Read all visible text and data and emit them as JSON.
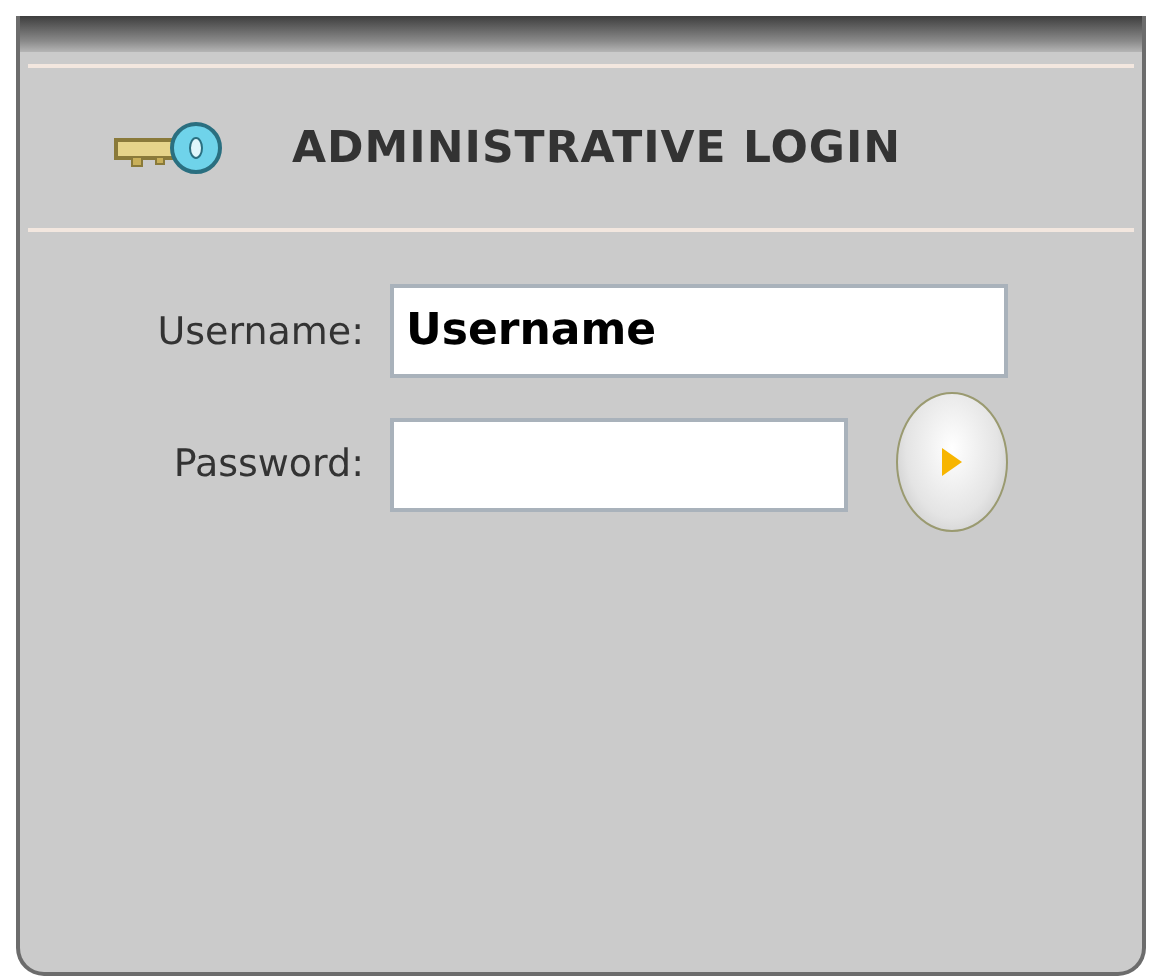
{
  "panel": {
    "title": "ADMINISTRATIVE LOGIN"
  },
  "fields": [
    {
      "label": "Username:",
      "kind": "text",
      "value": "Username"
    },
    {
      "label": "Password:",
      "kind": "password"
    }
  ]
}
